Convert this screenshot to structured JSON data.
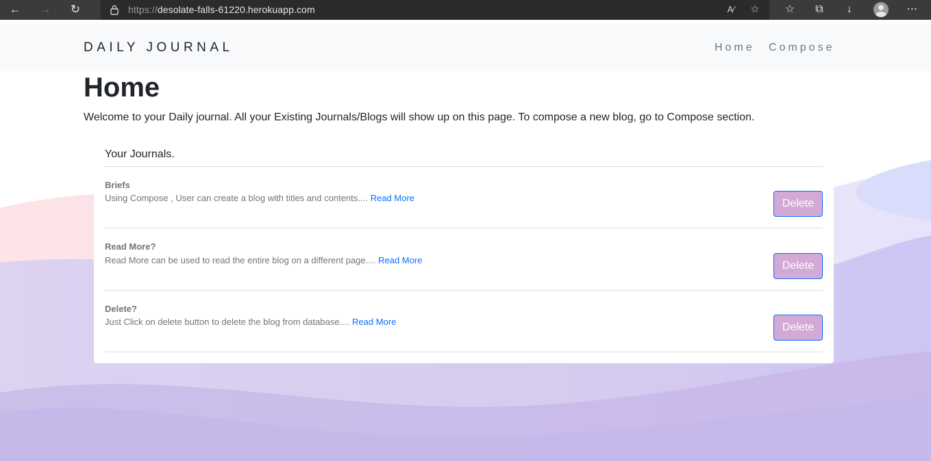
{
  "browser": {
    "url_protocol": "https://",
    "url_host": "desolate-falls-61220.herokuapp.com"
  },
  "navbar": {
    "brand": "DAILY JOURNAL",
    "links": [
      "Home",
      "Compose"
    ]
  },
  "page": {
    "title": "Home",
    "welcome": "Welcome to your Daily journal. All your Existing Journals/Blogs will show up on this page. To compose a new blog, go to Compose section."
  },
  "journals": {
    "header": "Your Journals.",
    "read_more_label": "Read More",
    "delete_label": "Delete",
    "entries": [
      {
        "title": "Briefs",
        "excerpt": "Using Compose , User can create a blog with titles and contents...."
      },
      {
        "title": "Read More?",
        "excerpt": "Read More can be used to read the entire blog on a different page...."
      },
      {
        "title": "Delete?",
        "excerpt": "Just Click on delete button to delete the blog from database...."
      }
    ]
  },
  "colors": {
    "delete_button_bg": "#d3a9d6",
    "delete_button_border": "#0d6efd",
    "link": "#0d6efd",
    "navbar_bg": "#f8f9fa"
  }
}
